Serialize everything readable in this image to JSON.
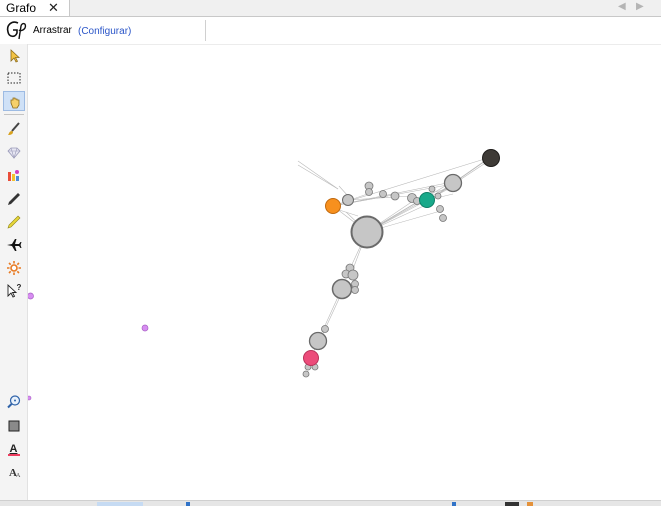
{
  "tab": {
    "label": "Grafo",
    "close_glyph": "✕"
  },
  "nav": {
    "prev": "◀",
    "next": "▶"
  },
  "toolbar": {
    "active_tool_name": "Arrastrar",
    "config_link": "(Configurar)"
  },
  "sidebar": {
    "tools": [
      {
        "name": "select-arrow-icon"
      },
      {
        "name": "rectangle-select-icon"
      },
      {
        "name": "drag-hand-icon",
        "active": true
      },
      {
        "name": "brush-icon"
      },
      {
        "name": "diamond-painter-icon"
      },
      {
        "name": "heat-bar-icon"
      },
      {
        "name": "pencil-icon"
      },
      {
        "name": "edge-pencil-icon"
      },
      {
        "name": "airplane-icon"
      },
      {
        "name": "sun-icon"
      },
      {
        "name": "help-cursor-icon"
      },
      {
        "name": "zoom-in-icon"
      },
      {
        "name": "background-color-icon"
      },
      {
        "name": "font-color-icon"
      },
      {
        "name": "font-size-icon"
      }
    ],
    "help_glyph": "?",
    "font_glyph": "A"
  },
  "colors": {
    "node_gray": "#c4c4c4",
    "node_stroke": "#6e6e6e",
    "orange": "#f7901e",
    "teal": "#19a98a",
    "dark": "#3e3a36",
    "pink": "#ec4c7a",
    "violet": "#d78df1",
    "edge": "#b8b8b8",
    "link": "#2a55c8"
  }
}
